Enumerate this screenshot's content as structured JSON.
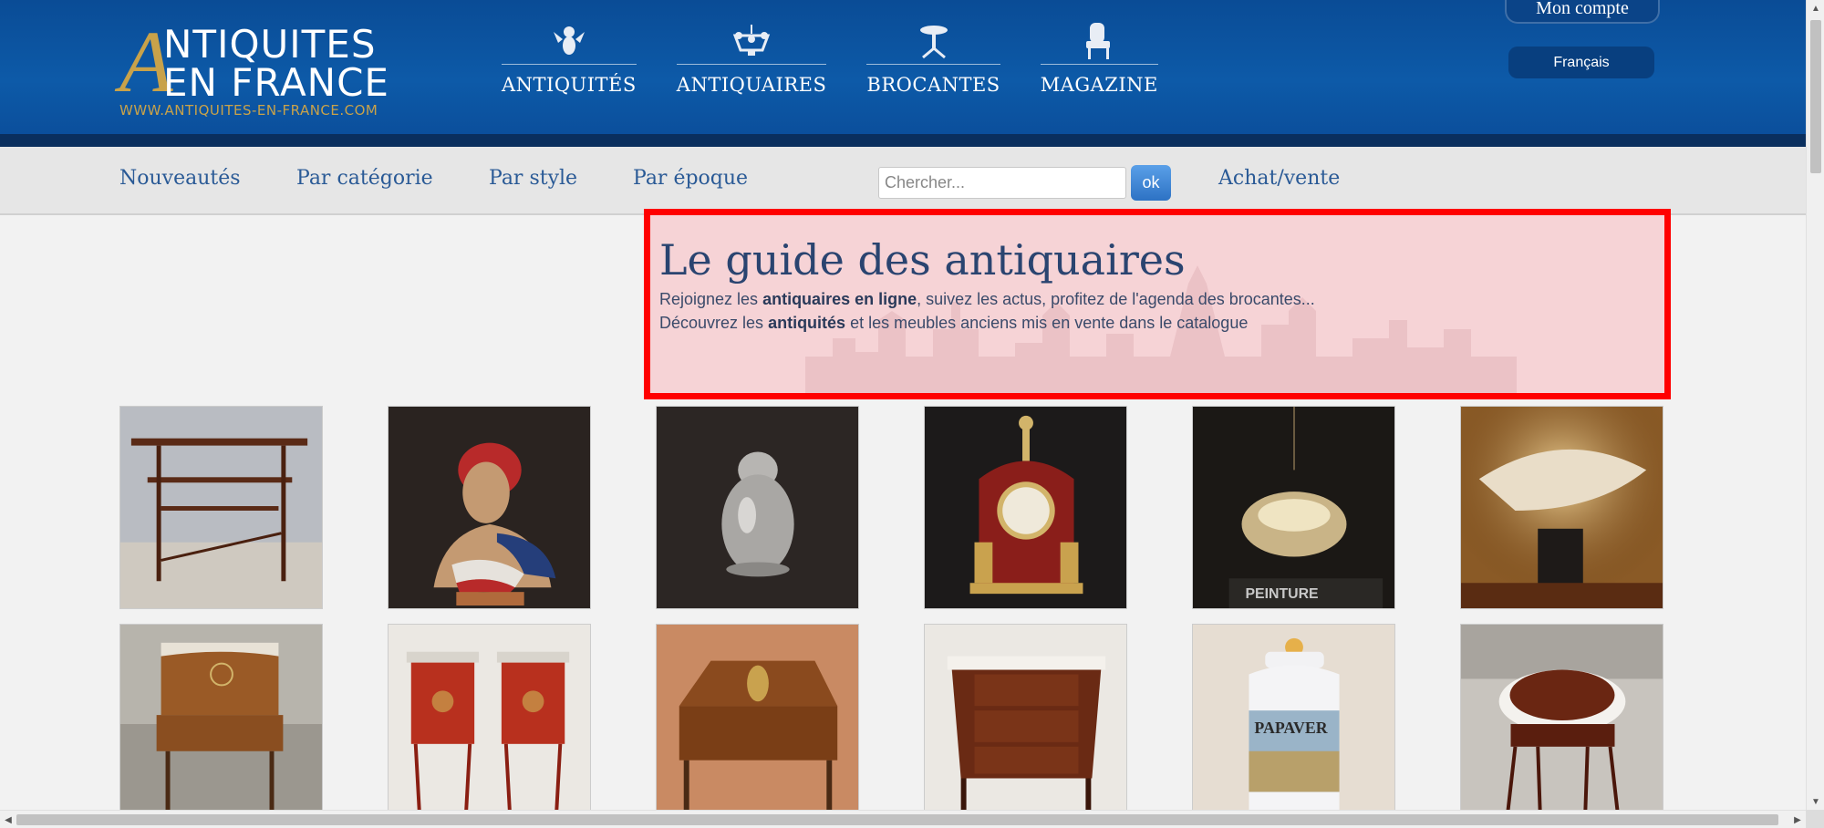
{
  "header": {
    "logo": {
      "big_letter": "A",
      "line1": "NTIQUITES",
      "line2": "EN FRANCE",
      "url": "WWW.ANTIQUITES-EN-FRANCE.COM"
    },
    "nav": [
      {
        "label": "ANTIQUITÉS",
        "icon": "cherub-icon"
      },
      {
        "label": "ANTIQUAIRES",
        "icon": "chandelier-icon"
      },
      {
        "label": "BROCANTES",
        "icon": "pedestal-table-icon"
      },
      {
        "label": "MAGAZINE",
        "icon": "armchair-icon"
      }
    ],
    "account_label": "Mon compte",
    "language_label": "Français"
  },
  "subnav": {
    "links": [
      "Nouveautés",
      "Par catégorie",
      "Par style",
      "Par époque"
    ],
    "search_placeholder": "Chercher...",
    "search_button": "ok",
    "buy_sell": "Achat/vente"
  },
  "hero": {
    "title": "Le guide des antiquaires",
    "line1": {
      "pre": "Rejoignez les ",
      "bold": "antiquaires en ligne",
      "post": ", suivez les actus, profitez de l'agenda des brocantes..."
    },
    "line2": {
      "pre": "Découvrez les ",
      "bold": "antiquités",
      "post": " et les meubles anciens mis en vente dans le catalogue"
    }
  },
  "products": [
    {
      "name": "serving-trolley",
      "text": ""
    },
    {
      "name": "marianne-bust",
      "text": ""
    },
    {
      "name": "silver-figurine",
      "text": ""
    },
    {
      "name": "boulle-clock",
      "text": ""
    },
    {
      "name": "crystal-pendant-light",
      "text": "PEINTURE"
    },
    {
      "name": "dome-lamp",
      "text": ""
    },
    {
      "name": "cylinder-desk",
      "text": ""
    },
    {
      "name": "red-nightstands",
      "text": ""
    },
    {
      "name": "slant-front-desk",
      "text": ""
    },
    {
      "name": "demilune-commode",
      "text": ""
    },
    {
      "name": "apothecary-jar",
      "text": "PAPAVER"
    },
    {
      "name": "round-side-table",
      "text": ""
    }
  ]
}
